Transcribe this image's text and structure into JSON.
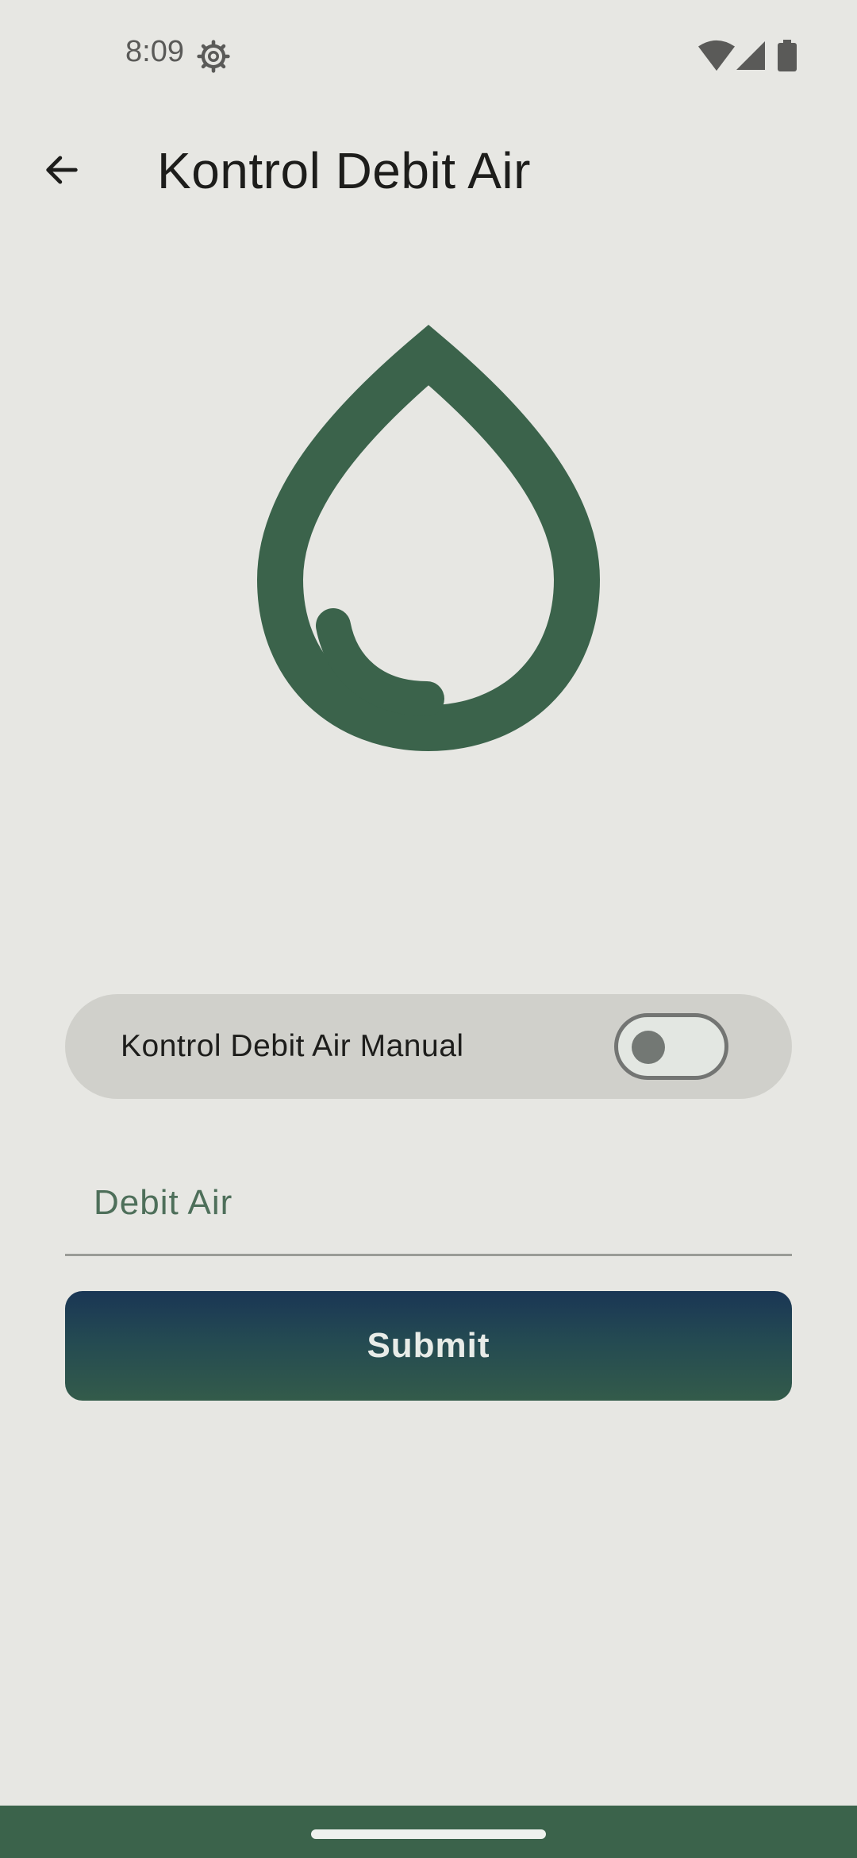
{
  "status_bar": {
    "time": "8:09",
    "icons": [
      "gear-icon",
      "wifi-icon",
      "signal-icon",
      "battery-icon"
    ]
  },
  "app_bar": {
    "back_icon": "arrow-left-icon",
    "title": "Kontrol Debit Air"
  },
  "hero": {
    "icon": "water-drop-icon",
    "color": "#3b634b"
  },
  "manual_control": {
    "label": "Kontrol Debit Air Manual",
    "enabled": false
  },
  "debit_field": {
    "placeholder": "Debit Air",
    "value": ""
  },
  "submit": {
    "label": "Submit"
  },
  "colors": {
    "background": "#e7e7e3",
    "primary_green": "#3b634b",
    "primary_navy": "#1a3655",
    "card": "#d0d0cb"
  }
}
